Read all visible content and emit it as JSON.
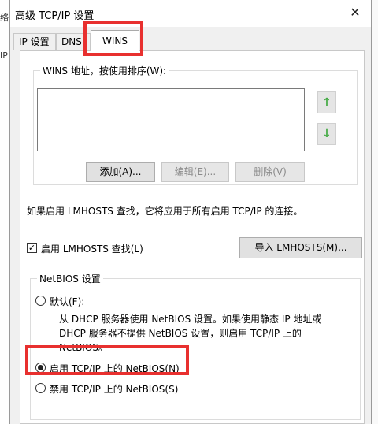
{
  "window": {
    "title": "高级 TCP/IP 设置",
    "close_glyph": "✕"
  },
  "background": {
    "left_text_1": "络",
    "left_text_2": "IP"
  },
  "tabs": [
    {
      "label": "IP 设置"
    },
    {
      "label": "DNS"
    },
    {
      "label": "WINS"
    }
  ],
  "wins": {
    "group_label": "WINS 地址，按使用排序(W):",
    "up_arrow": "↑",
    "down_arrow": "↓",
    "add_label": "添加(A)...",
    "edit_label": "编辑(E)...",
    "delete_label": "删除(V)"
  },
  "lmhosts": {
    "info_text": "如果启用 LMHOSTS 查找，它将应用于所有启用 TCP/IP 的连接。",
    "enable_label": "启用 LMHOSTS 查找(L)",
    "enable_checked": true,
    "check_glyph": "✓",
    "import_label": "导入 LMHOSTS(M)..."
  },
  "netbios": {
    "group_label": "NetBIOS 设置",
    "default_label": "默认(F):",
    "default_desc_1": "从 DHCP 服务器使用 NetBIOS 设置。如果使用静态 IP 地址或",
    "default_desc_2": "DHCP 服务器不提供 NetBIOS 设置，则启用 TCP/IP 上的",
    "default_desc_3": "NetBIOS。",
    "enable_label": "启用 TCP/IP 上的 NetBIOS(N)",
    "disable_label": "禁用 TCP/IP 上的 NetBIOS(S)",
    "selected": "enable"
  },
  "colors": {
    "highlight": "#e8302f",
    "arrow": "#3ea83e"
  }
}
